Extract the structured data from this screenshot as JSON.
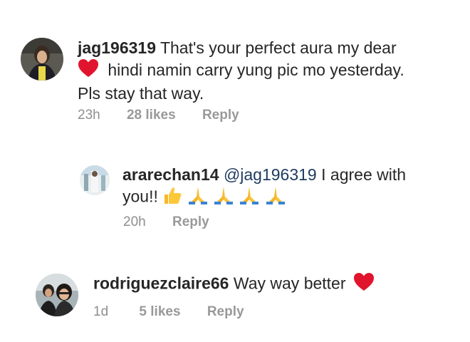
{
  "comments": [
    {
      "username": "jag196319",
      "text_before_emoji": "That's your perfect aura my dear",
      "emoji_1": "heart-emoji",
      "text_after_emoji": "hindi namin carry yung pic mo yesterday.",
      "text_line3": "Pls stay that way.",
      "time": "23h",
      "likes": "28 likes",
      "reply_label": "Reply"
    },
    {
      "username": "ararechan14",
      "mention": "@jag196319",
      "text": "I agree with",
      "text_line2": "you!!",
      "emojis": [
        "thumbs-up-emoji",
        "folded-hands-emoji",
        "folded-hands-emoji",
        "folded-hands-emoji",
        "folded-hands-emoji"
      ],
      "time": "20h",
      "reply_label": "Reply"
    },
    {
      "username": "rodriguezclaire66",
      "text": "Way way better",
      "emoji_1": "heart-emoji",
      "time": "1d",
      "likes": "5 likes",
      "reply_label": "Reply"
    }
  ],
  "colors": {
    "text": "#262626",
    "meta": "#8e8e8e",
    "mention": "#1d3a5f",
    "heart": "#e0142c"
  }
}
